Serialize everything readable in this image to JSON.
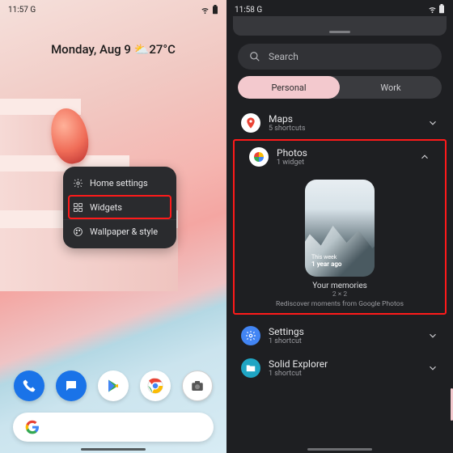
{
  "left": {
    "status_time": "11:57",
    "status_g": "G",
    "date_prefix": "Monday, Aug 9 ",
    "weather_icon": "⛅",
    "temp": "27°C",
    "ctx": {
      "home_settings": "Home settings",
      "widgets": "Widgets",
      "wallpaper": "Wallpaper & style"
    },
    "dock": {
      "phone": "phone",
      "messages": "messages",
      "play": "play-store",
      "chrome": "chrome",
      "camera": "camera"
    }
  },
  "right": {
    "status_time": "11:58",
    "status_g": "G",
    "search_placeholder": "Search",
    "tabs": {
      "personal": "Personal",
      "work": "Work"
    },
    "rows": {
      "maps": {
        "name": "Maps",
        "sub": "5 shortcuts"
      },
      "photos": {
        "name": "Photos",
        "sub": "1 widget"
      },
      "settings": {
        "name": "Settings",
        "sub": "1 shortcut"
      },
      "explorer": {
        "name": "Solid Explorer",
        "sub": "1 shortcut"
      }
    },
    "preview": {
      "line1": "This week",
      "line2": "1 year ago",
      "title": "Your memories",
      "size": "2 × 2",
      "desc": "Rediscover moments from Google Photos"
    }
  },
  "colors": {
    "highlight": "#ff1a1a",
    "pill": "#f3c9ce"
  }
}
